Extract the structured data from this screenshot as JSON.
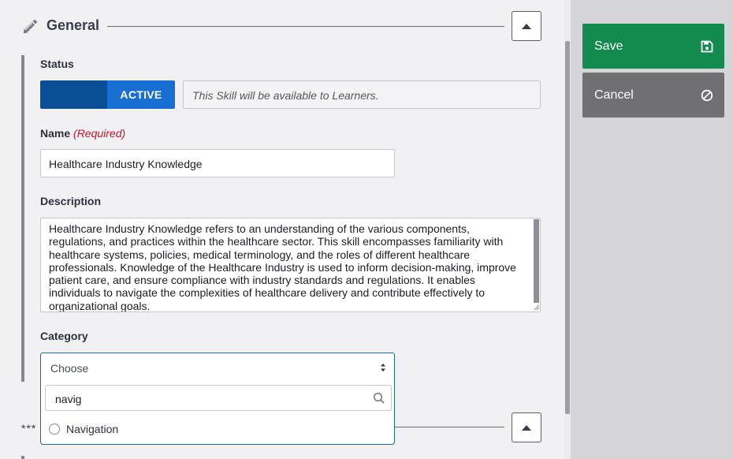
{
  "section": {
    "title": "General"
  },
  "status": {
    "label": "Status",
    "toggle_value": "ACTIVE",
    "note": "This Skill will be available to Learners."
  },
  "name": {
    "label": "Name",
    "required": "(Required)",
    "value": "Healthcare Industry Knowledge"
  },
  "description": {
    "label": "Description",
    "value": "Healthcare Industry Knowledge refers to an understanding of the various components, regulations, and practices within the healthcare sector. This skill encompasses familiarity with healthcare systems, policies, medical terminology, and the roles of different healthcare professionals. Knowledge of the Healthcare Industry is used to inform decision-making, improve patient care, and ensure compliance with industry standards and regulations. It enables individuals to navigate the complexities of healthcare delivery and contribute effectively to organizational goals."
  },
  "category": {
    "label": "Category",
    "placeholder": "Choose",
    "search_value": "navig",
    "options": [
      "Navigation"
    ]
  },
  "next_section": {
    "title_masked": "***"
  },
  "actions": {
    "save_label": "Save",
    "cancel_label": "Cancel"
  },
  "icons": {
    "section": "pencil-icon",
    "collapse": "chevron-up-icon",
    "save": "floppy-disk-icon",
    "cancel": "ban-icon",
    "search": "search-icon",
    "select": "sort-arrows-icon"
  },
  "colors": {
    "save": "#138a4e",
    "cancel": "#6f6f74",
    "toggle_active": "#1770d1",
    "toggle_track": "#0a4f96",
    "required": "#c4142e",
    "select_focus": "#1f6a9c"
  }
}
